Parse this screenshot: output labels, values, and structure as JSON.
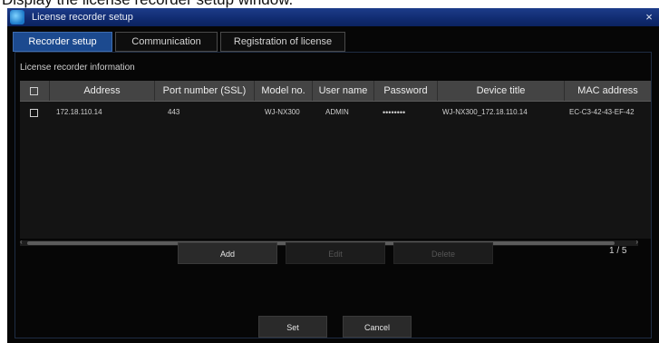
{
  "caption": "Display the license recorder setup window.",
  "window": {
    "title": "License recorder setup",
    "close_glyph": "×",
    "icon": "app-icon"
  },
  "tabs": [
    {
      "label": "Recorder setup",
      "active": true
    },
    {
      "label": "Communication",
      "active": false
    },
    {
      "label": "Registration of license",
      "active": false
    }
  ],
  "section": {
    "label": "License recorder information"
  },
  "table": {
    "columns": [
      "Address",
      "Port number (SSL)",
      "Model no.",
      "User name",
      "Password",
      "Device title",
      "MAC address"
    ],
    "rows": [
      {
        "checked": false,
        "cells": [
          "172.18.110.14",
          "443",
          "WJ-NX300",
          "ADMIN",
          "••••••••",
          "WJ-NX300_172.18.110.14",
          "EC-C3-42-43-EF-42"
        ]
      }
    ]
  },
  "buttons": {
    "add": "Add",
    "edit": "Edit",
    "delete": "Delete",
    "set": "Set",
    "cancel": "Cancel"
  },
  "pagination": {
    "text": "1 / 5"
  },
  "colors": {
    "window_bg": "#060606",
    "titlebar": "#102b70",
    "active_tab": "#1c4a8f",
    "header_bg": "#444444"
  }
}
